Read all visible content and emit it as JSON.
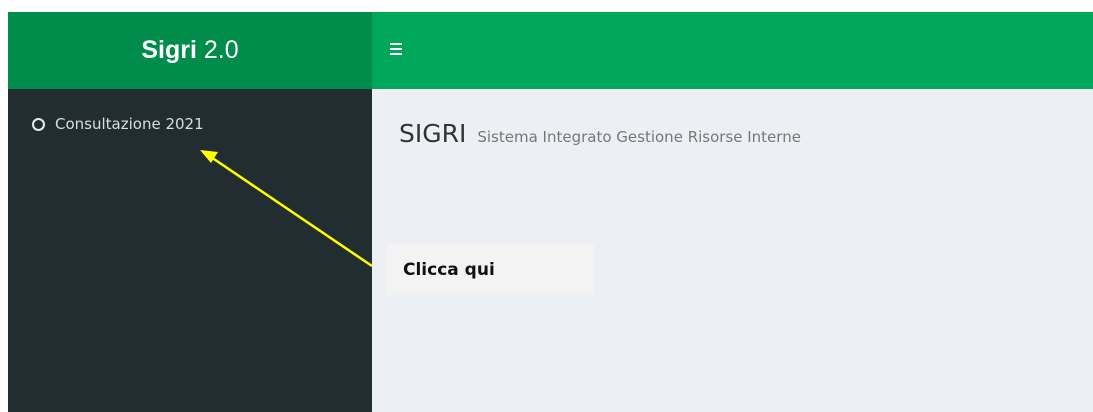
{
  "header": {
    "logo_bold": "Sigri",
    "logo_version": "2.0",
    "menu_toggle_icon": "hamburger-icon"
  },
  "sidebar": {
    "items": [
      {
        "label": "Consultazione 2021",
        "icon": "circle-outline-icon"
      }
    ]
  },
  "content": {
    "title": "SIGRI",
    "subtitle": "Sistema Integrato Gestione Risorse Interne"
  },
  "annotation": {
    "callout_text": "Clicca qui",
    "arrow_color": "#ffff00"
  },
  "colors": {
    "logo_bg": "#008d4c",
    "navbar_bg": "#00a65a",
    "sidebar_bg": "#222d32",
    "content_bg": "#ecf0f5"
  }
}
